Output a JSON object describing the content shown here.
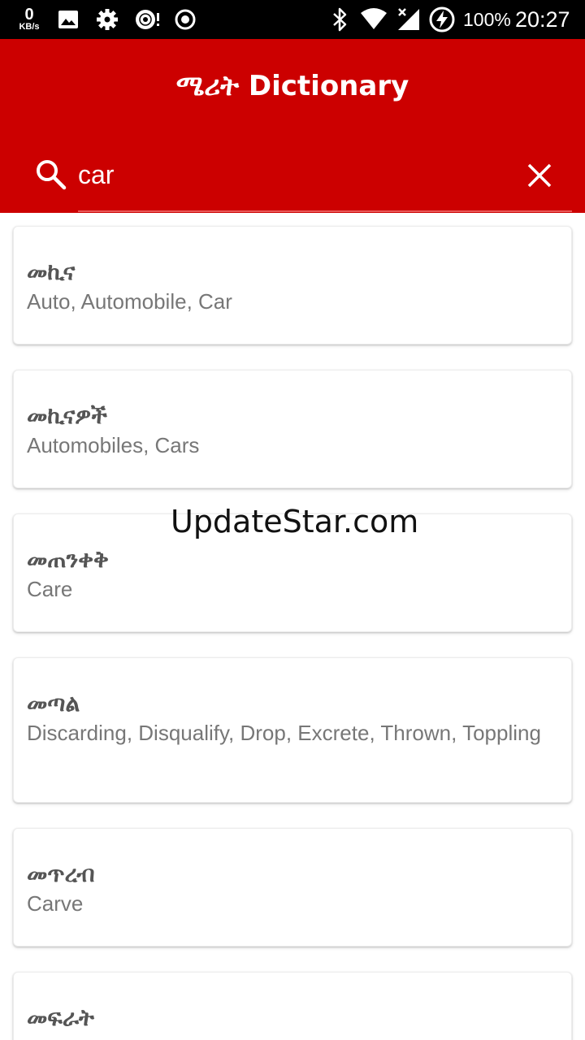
{
  "status_bar": {
    "net_speed_value": "0",
    "net_speed_unit": "KB/s",
    "battery_percent": "100%",
    "time": "20:27",
    "icons": [
      "image-icon",
      "settings-gear-icon",
      "disc-icon",
      "record-icon",
      "bluetooth-icon",
      "wifi-icon",
      "no-signal-icon",
      "battery-charging-icon"
    ]
  },
  "app_bar": {
    "title": "ሜሪት Dictionary",
    "background_color": "#cc0000"
  },
  "search": {
    "value": "car",
    "placeholder": ""
  },
  "results": [
    {
      "word": "መኪና",
      "meaning": "Auto, Automobile, Car"
    },
    {
      "word": "መኪናዎች",
      "meaning": "Automobiles, Cars"
    },
    {
      "word": "መጠንቀቅ",
      "meaning": "Care"
    },
    {
      "word": "መጣል",
      "meaning": "Discarding, Disqualify, Drop, Excrete, Thrown, Toppling"
    },
    {
      "word": "መጥረብ",
      "meaning": "Carve"
    },
    {
      "word": "መፍራት",
      "meaning": ""
    }
  ],
  "watermark": "UpdateStar.com"
}
